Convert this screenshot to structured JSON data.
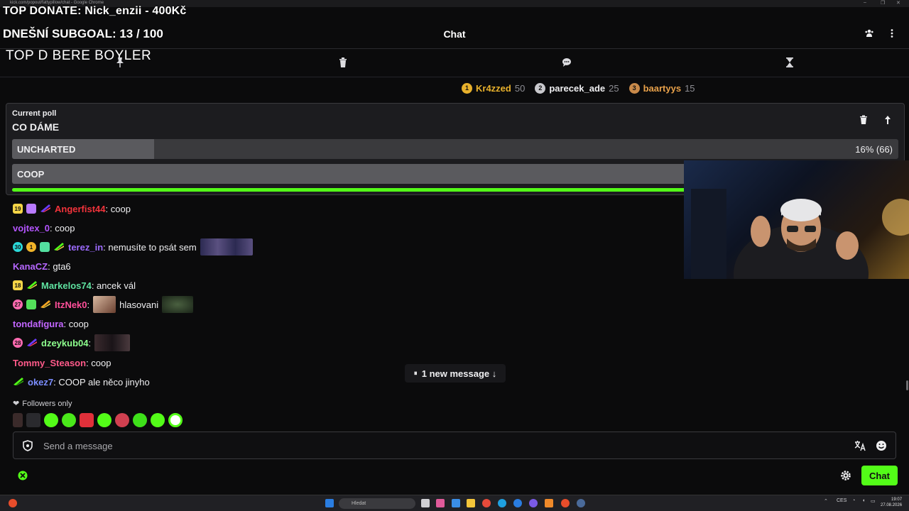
{
  "browser": {
    "title": "kick.com/popout/fattypillow/chat - Google Chrome",
    "controls": [
      "–",
      "❐",
      "✕"
    ]
  },
  "overlay": {
    "top_donate": "TOP DONATE: Nick_enzii - 400Kč",
    "subgoal": "DNEŠNÍ SUBGOAL: 13 / 100",
    "banner": "TOP D BERE BOYLER"
  },
  "header": {
    "title": "Chat",
    "icons": [
      "users-icon",
      "more-icon"
    ]
  },
  "modes": [
    "pin-icon",
    "trash-icon",
    "chat-bubble-icon",
    "hourglass-icon"
  ],
  "leaderboard": [
    {
      "rank": "1",
      "name": "Kr4zzed",
      "value": "50",
      "color": "#e8b12c"
    },
    {
      "rank": "2",
      "name": "parecek_ade",
      "value": "25",
      "color": "#c9c9cd"
    },
    {
      "rank": "3",
      "name": "baartyys",
      "value": "15",
      "color": "#c98a4a"
    }
  ],
  "poll": {
    "label": "Current poll",
    "question": "CO DÁME",
    "options": [
      {
        "label": "UNCHARTED",
        "stat": "16% (66)",
        "percent": 16
      },
      {
        "label": "COOP",
        "stat": "",
        "percent": 84
      }
    ],
    "time_remaining": 0.91
  },
  "messages": [
    {
      "user": "Angerfist44",
      "color": "#f2333b",
      "text": ": coop",
      "badges": [
        "19",
        "gift",
        "kick"
      ]
    },
    {
      "user": "vojtex_0",
      "color": "#b455ff",
      "text": ": coop",
      "badges": []
    },
    {
      "user": "terez_in",
      "color": "#9d6bff",
      "text": ": nemusíte to psát sem",
      "badges": [
        "30",
        "1",
        "gift",
        "kick"
      ]
    },
    {
      "user": "KanaCZ",
      "color": "#b667ff",
      "text": ": gta6",
      "badges": []
    },
    {
      "user": "Markelos74",
      "color": "#5fe3a1",
      "text": ": ancek vál",
      "badges": [
        "18",
        "kick"
      ]
    },
    {
      "user": "ItzNek0",
      "color": "#ff4f9a",
      "text": "hlasovani",
      "badges": [
        "27",
        "gift",
        "kick"
      ]
    },
    {
      "user": "tondafigura",
      "color": "#c266ff",
      "text": ": coop",
      "badges": []
    },
    {
      "user": "dzeykub04",
      "color": "#8eff8e",
      "text": ":",
      "badges": [
        "28",
        "kick"
      ]
    },
    {
      "user": "Tommy_Steason",
      "color": "#ff5a8a",
      "text": ": coop",
      "badges": []
    },
    {
      "user": "okez7",
      "color": "#7b8dff",
      "text": ": COOP ale něco jinyho",
      "badges": [
        "kick"
      ]
    }
  ],
  "new_message": {
    "label": "1 new message ↓",
    "pause_icon": "⏸"
  },
  "followers_only": "Followers only",
  "input": {
    "placeholder": "Send a message"
  },
  "chat_button": "Chat",
  "taskbar": {
    "search_placeholder": "Hledat",
    "time": "19:07",
    "date": "27.08.2026",
    "lang": "CES"
  },
  "colors": {
    "accent": "#53fc18",
    "panel": "#1c1c1f",
    "background": "#0b0b0c"
  }
}
